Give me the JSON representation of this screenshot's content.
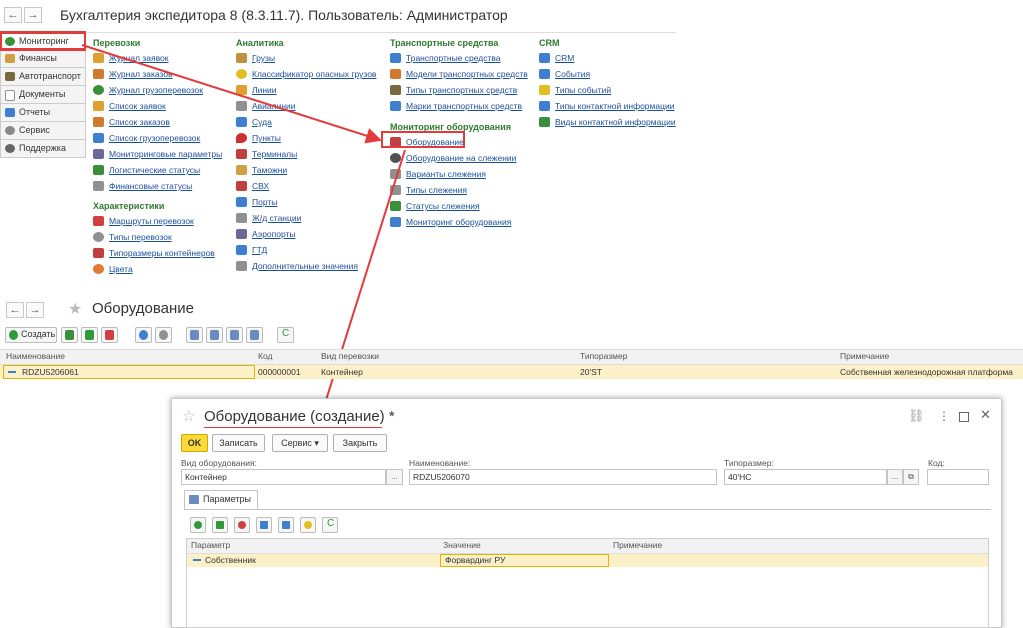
{
  "app": {
    "title": "Бухгалтерия экспедитора 8 (8.3.11.7). Пользователь: Администратор",
    "back_glyph": "←",
    "forward_glyph": "→"
  },
  "sidebar": {
    "items": [
      {
        "label": "Мониторинг",
        "icon": "globe-icon",
        "color": "#3a8f3a"
      },
      {
        "label": "Финансы",
        "icon": "money-icon",
        "color": "#d0a040"
      },
      {
        "label": "Автотранспорт",
        "icon": "truck-icon",
        "color": "#7a6a40"
      },
      {
        "label": "Документы",
        "icon": "document-icon",
        "color": "#909090"
      },
      {
        "label": "Отчеты",
        "icon": "chart-icon",
        "color": "#3f7fcf"
      },
      {
        "label": "Сервис",
        "icon": "gear-icon",
        "color": "#888888"
      },
      {
        "label": "Поддержка",
        "icon": "support-icon",
        "color": "#666666"
      }
    ]
  },
  "menu": {
    "perevozki": {
      "header": "Перевозки",
      "items": [
        {
          "label": "Журнал заявок",
          "color": "#e0a030"
        },
        {
          "label": "Журнал заказов",
          "color": "#d07a30"
        },
        {
          "label": "Журнал грузоперевозок",
          "color": "#3a8f3a"
        },
        {
          "label": "Список заявок",
          "color": "#e0a030"
        },
        {
          "label": "Список заказов",
          "color": "#d07a30"
        },
        {
          "label": "Список грузоперевозок",
          "color": "#3f7fcf"
        },
        {
          "label": "Мониторинговые параметры",
          "color": "#6a6a9a"
        },
        {
          "label": "Логистические статусы",
          "color": "#3a8f3a"
        },
        {
          "label": "Финансовые статусы",
          "color": "#909090"
        }
      ]
    },
    "harakteristiki": {
      "header": "Характеристики",
      "items": [
        {
          "label": "Маршруты перевозок",
          "color": "#d04040"
        },
        {
          "label": "Типы перевозок",
          "color": "#909090"
        },
        {
          "label": "Типоразмеры контейнеров",
          "color": "#c04040"
        },
        {
          "label": "Цвета",
          "color": "#e07a30"
        }
      ]
    },
    "analitika": {
      "header": "Аналитика",
      "items": [
        {
          "label": "Грузы",
          "color": "#c09040"
        },
        {
          "label": "Классификатор опасных грузов",
          "color": "#e0c020"
        },
        {
          "label": "Линии",
          "color": "#e0a030"
        },
        {
          "label": "Авиалинии",
          "color": "#909090"
        },
        {
          "label": "Суда",
          "color": "#3f7fcf"
        },
        {
          "label": "Пункты",
          "color": "#d03030"
        },
        {
          "label": "Терминалы",
          "color": "#c04040"
        },
        {
          "label": "Таможни",
          "color": "#d0a040"
        },
        {
          "label": "СВХ",
          "color": "#c04040"
        },
        {
          "label": "Порты",
          "color": "#3f7fcf"
        },
        {
          "label": "Ж/д станции",
          "color": "#909090"
        },
        {
          "label": "Аэропорты",
          "color": "#6a6a9a"
        },
        {
          "label": "ГТД",
          "color": "#3f7fcf"
        },
        {
          "label": "Дополнительные значения",
          "color": "#909090"
        }
      ]
    },
    "transport": {
      "header": "Транспортные средства",
      "items": [
        {
          "label": "Транспортные средства",
          "color": "#3f7fcf"
        },
        {
          "label": "Модели транспортных средств",
          "color": "#d07a30"
        },
        {
          "label": "Типы транспортных средств",
          "color": "#7a6a40"
        },
        {
          "label": "Марки транспортных средств",
          "color": "#3f7fcf"
        }
      ]
    },
    "monitoring": {
      "header": "Мониторинг оборудования",
      "items": [
        {
          "label": "Оборудование",
          "color": "#c04040"
        },
        {
          "label": "Оборудование на слежении",
          "color": "#505050"
        },
        {
          "label": "Варианты слежения",
          "color": "#909090"
        },
        {
          "label": "Типы слежения",
          "color": "#909090"
        },
        {
          "label": "Статусы слежения",
          "color": "#3a8f3a"
        },
        {
          "label": "Мониторинг оборудования",
          "color": "#3f7fcf"
        }
      ]
    },
    "crm": {
      "header": "CRM",
      "items": [
        {
          "label": "CRM",
          "color": "#3f7fcf"
        },
        {
          "label": "События",
          "color": "#3f7fcf"
        },
        {
          "label": "Типы событий",
          "color": "#e0c020"
        },
        {
          "label": "Типы контактной информации",
          "color": "#3f7fcf"
        },
        {
          "label": "Виды контактной информации",
          "color": "#3a8f3a"
        }
      ]
    }
  },
  "list": {
    "title": "Оборудование",
    "toolbar": {
      "create_label": "Создать"
    },
    "columns": [
      "Наименование",
      "Код",
      "Вид перевозки",
      "Типоразмер",
      "Примечание"
    ],
    "rows": [
      {
        "name": "RDZU5206061",
        "code": "000000001",
        "kind": "Контейнер",
        "size": "20'ST",
        "note": "Собственная железнодорожная платформа"
      }
    ]
  },
  "dialog": {
    "title": "Оборудование (создание) *",
    "buttons": {
      "ok": "OK",
      "save": "Записать",
      "service": "Сервис ▾",
      "close": "Закрыть"
    },
    "fields": {
      "kind_label": "Вид оборудования:",
      "kind_value": "Контейнер",
      "name_label": "Наименование:",
      "name_value": "RDZU5206070",
      "size_label": "Типоразмер:",
      "size_value": "40'HC",
      "code_label": "Код:",
      "code_value": ""
    },
    "tab_label": "Параметры",
    "table": {
      "columns": [
        "Параметр",
        "Значение",
        "Примечание"
      ],
      "rows": [
        {
          "param": "Собственник",
          "value": "Форвардинг РУ",
          "note": ""
        }
      ]
    }
  },
  "colors": {
    "accent_red": "#e23b3b",
    "link_blue": "#1a4f9c",
    "header_green": "#2f7a2f",
    "selected_row": "#fbf0c8",
    "ok_yellow": "#ffd83a"
  }
}
